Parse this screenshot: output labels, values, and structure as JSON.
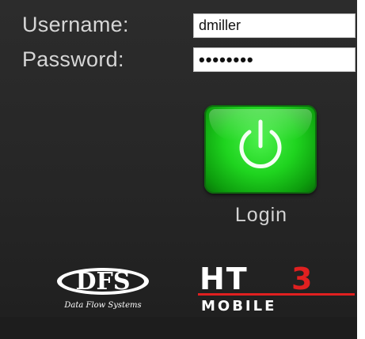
{
  "login_form": {
    "username_label": "Username:",
    "username_value": "dmiller",
    "password_label": "Password:",
    "password_value": "••••••••"
  },
  "login_button": {
    "icon": "power-icon",
    "label": "Login",
    "color": "#1fd41f"
  },
  "logos": {
    "dfs_mark": "DFS",
    "dfs_tagline": "Data Flow Systems",
    "ht3_mark": "HT3",
    "ht3_sub": "MOBILE",
    "ht3_accent_color": "#e02020"
  }
}
